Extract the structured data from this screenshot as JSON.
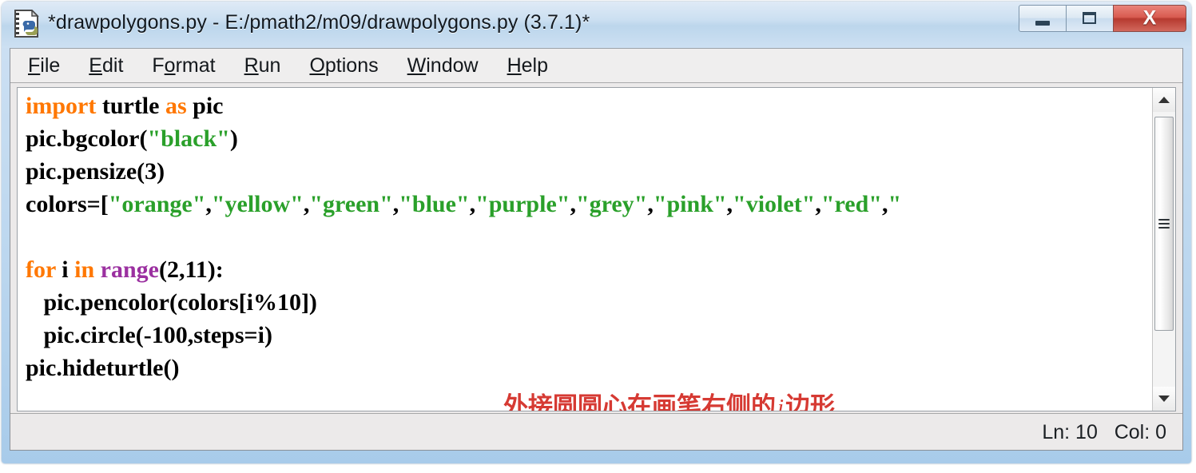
{
  "window": {
    "title": "*drawpolygons.py - E:/pmath2/m09/drawpolygons.py (3.7.1)*",
    "icon": "idle-python-file-icon",
    "controls": {
      "minimize_label": "—",
      "maximize_label": "□",
      "close_label": "X"
    }
  },
  "menubar": {
    "items": [
      {
        "label": "File",
        "accel": "F",
        "rest": "ile"
      },
      {
        "label": "Edit",
        "accel": "E",
        "rest": "dit"
      },
      {
        "label": "Format",
        "accel": "o",
        "pre": "F",
        "rest": "rmat"
      },
      {
        "label": "Run",
        "accel": "R",
        "rest": "un"
      },
      {
        "label": "Options",
        "accel": "O",
        "rest": "ptions"
      },
      {
        "label": "Window",
        "accel": "W",
        "rest": "indow"
      },
      {
        "label": "Help",
        "accel": "H",
        "rest": "elp"
      }
    ]
  },
  "editor": {
    "language": "python",
    "lines": [
      "import turtle as pic",
      "pic.bgcolor(\"black\")",
      "pic.pensize(3)",
      "colors=[\"orange\",\"yellow\",\"green\",\"blue\",\"purple\",\"grey\",\"pink\",\"violet\",\"red\",\"",
      "",
      "for i in range(2,11):",
      "    pic.pencolor(colors[i%10])",
      "    pic.circle(-100,steps=i)",
      "pic.hideturtle()"
    ],
    "syntax_colors": {
      "keyword": "#ff7700",
      "string": "#2aa02a",
      "builtin": "#9b30a0",
      "default": "#000000",
      "background": "#ffffff"
    }
  },
  "annotation": {
    "text_before": "外接圆圆心在画笔右侧的",
    "variable": "i",
    "text_after": "边形",
    "color": "#d63a33",
    "underline_target": "pic.circle(-100,steps=i)"
  },
  "scrollbar": {
    "up_arrow": "scroll-up-arrow",
    "down_arrow": "scroll-down-arrow",
    "orientation": "vertical"
  },
  "statusbar": {
    "position_text": "Ln: 10   Col: 0",
    "line": 10,
    "column": 0
  }
}
